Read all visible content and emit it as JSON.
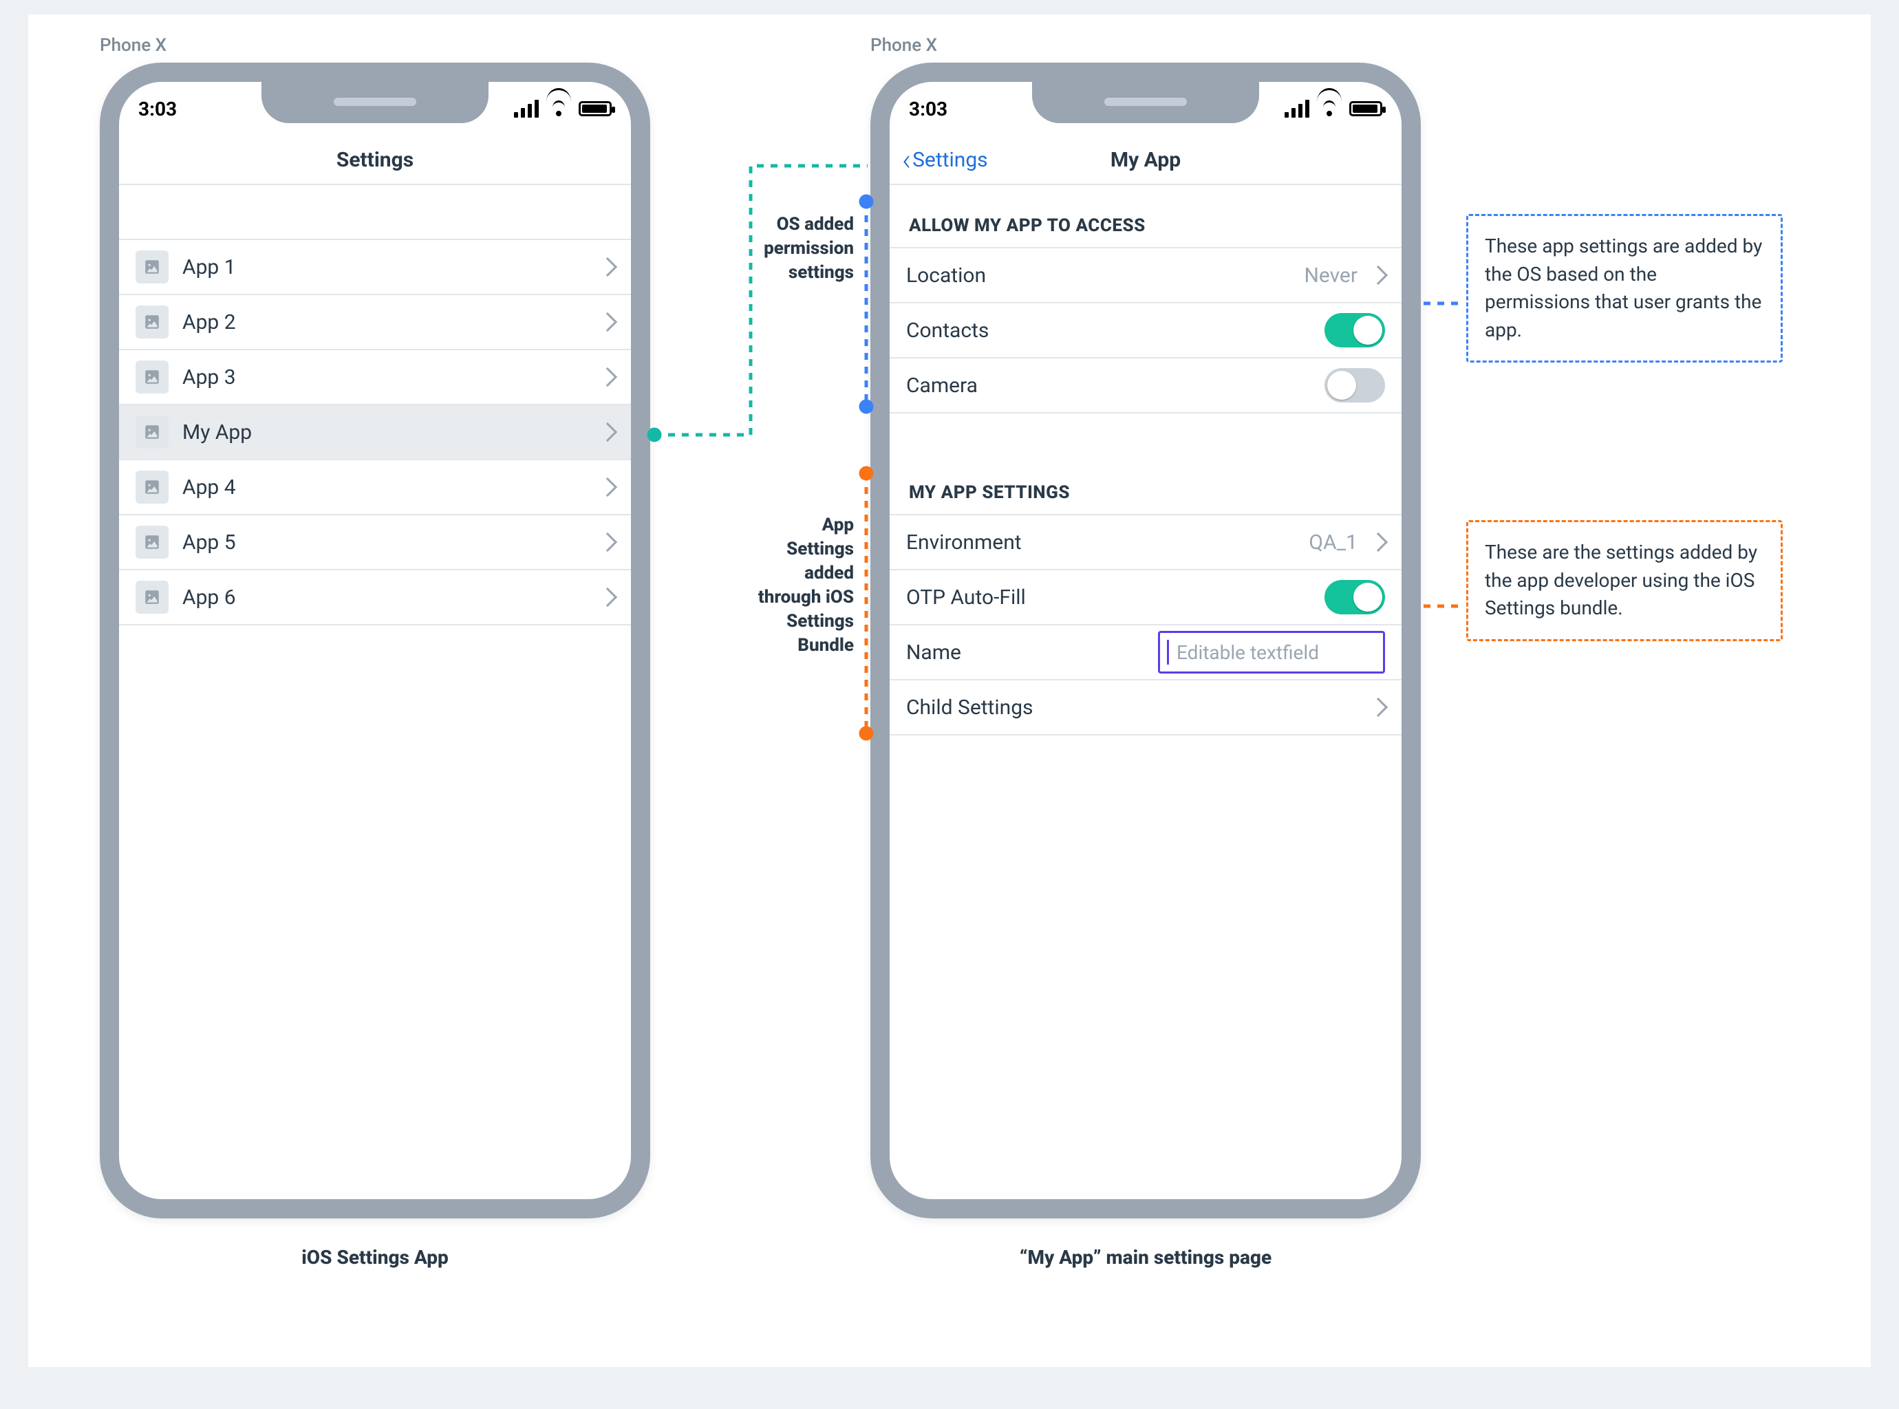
{
  "device_label": "Phone X",
  "status_time": "3:03",
  "phone1": {
    "title": "Settings",
    "apps": [
      {
        "label": "App 1"
      },
      {
        "label": "App 2"
      },
      {
        "label": "App 3"
      },
      {
        "label": "My App",
        "selected": true
      },
      {
        "label": "App 4"
      },
      {
        "label": "App 5"
      },
      {
        "label": "App 6"
      }
    ],
    "caption": "iOS Settings App"
  },
  "phone2": {
    "back_label": "Settings",
    "title": "My App",
    "section1_header": "ALLOW MY APP TO ACCESS",
    "section1_rows": {
      "location": {
        "label": "Location",
        "value": "Never"
      },
      "contacts": {
        "label": "Contacts",
        "toggle": "on"
      },
      "camera": {
        "label": "Camera",
        "toggle": "off"
      }
    },
    "section2_header": "MY APP SETTINGS",
    "section2_rows": {
      "environment": {
        "label": "Environment",
        "value": "QA_1"
      },
      "otp": {
        "label": "OTP Auto-Fill",
        "toggle": "on"
      },
      "name": {
        "label": "Name",
        "placeholder": "Editable textfield"
      },
      "child": {
        "label": "Child Settings"
      }
    },
    "caption": "“My App” main settings page"
  },
  "annotations": {
    "os_perms_line1": "OS added",
    "os_perms_line2": "permission",
    "os_perms_line3": "settings",
    "bundle_line1": "App",
    "bundle_line2": "Settings",
    "bundle_line3": "added",
    "bundle_line4": "through iOS",
    "bundle_line5": "Settings",
    "bundle_line6": "Bundle"
  },
  "callouts": {
    "blue": "These app settings are added by the OS based on the permissions that user grants the app.",
    "orange": "These are the settings added by the app developer using the iOS Settings bundle."
  }
}
